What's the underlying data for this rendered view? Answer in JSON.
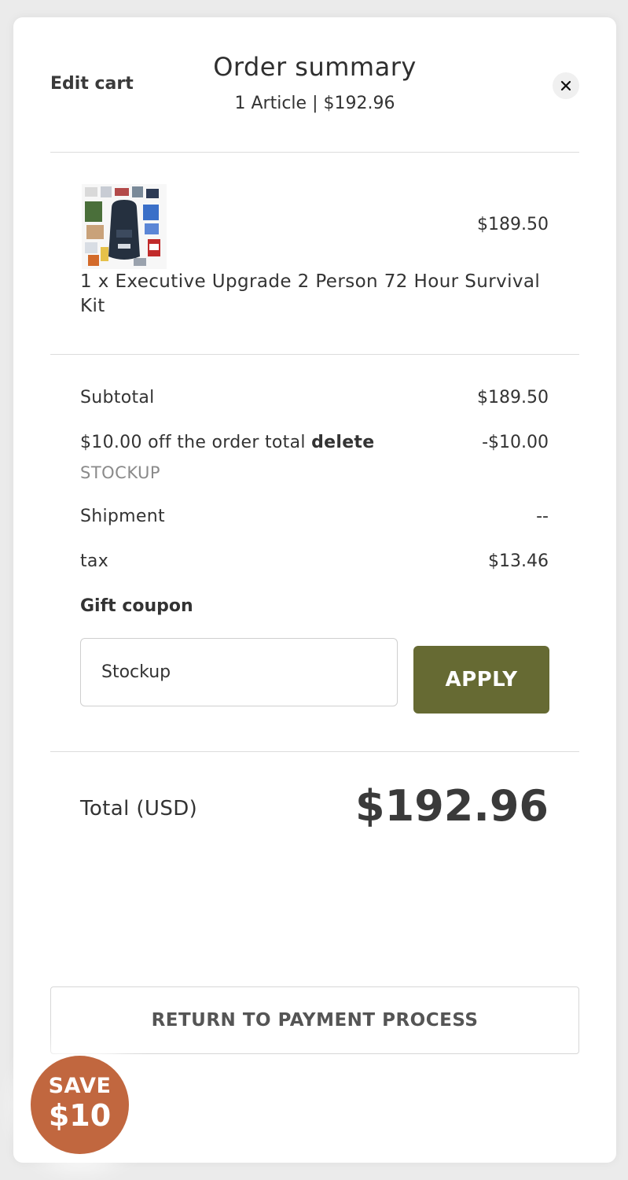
{
  "header": {
    "edit_label": "Edit cart",
    "title": "Order summary",
    "subtitle": "1 Article | $192.96",
    "close_icon": "close-icon"
  },
  "item": {
    "name": "1 x Executive Upgrade 2 Person 72 Hour Survival Kit",
    "price": "$189.50",
    "image_icon": "survival-kit-image"
  },
  "summary": {
    "subtotal_label": "Subtotal",
    "subtotal_value": "$189.50",
    "discount_label": "$10.00 off the order total",
    "discount_delete": "delete",
    "discount_code": "STOCKUP",
    "discount_value": "-$10.00",
    "shipment_label": "Shipment",
    "shipment_value": "--",
    "tax_label": "tax",
    "tax_value": "$13.46"
  },
  "coupon": {
    "label": "Gift coupon",
    "value": "Stockup",
    "apply_label": "APPLY"
  },
  "total": {
    "label": "Total (USD)",
    "value": "$192.96"
  },
  "return_label": "RETURN TO PAYMENT PROCESS",
  "badge": {
    "line1": "SAVE",
    "line2": "$10"
  },
  "colors": {
    "apply_button": "#666a33",
    "badge": "#c1673f",
    "background": "#ebebeb"
  }
}
